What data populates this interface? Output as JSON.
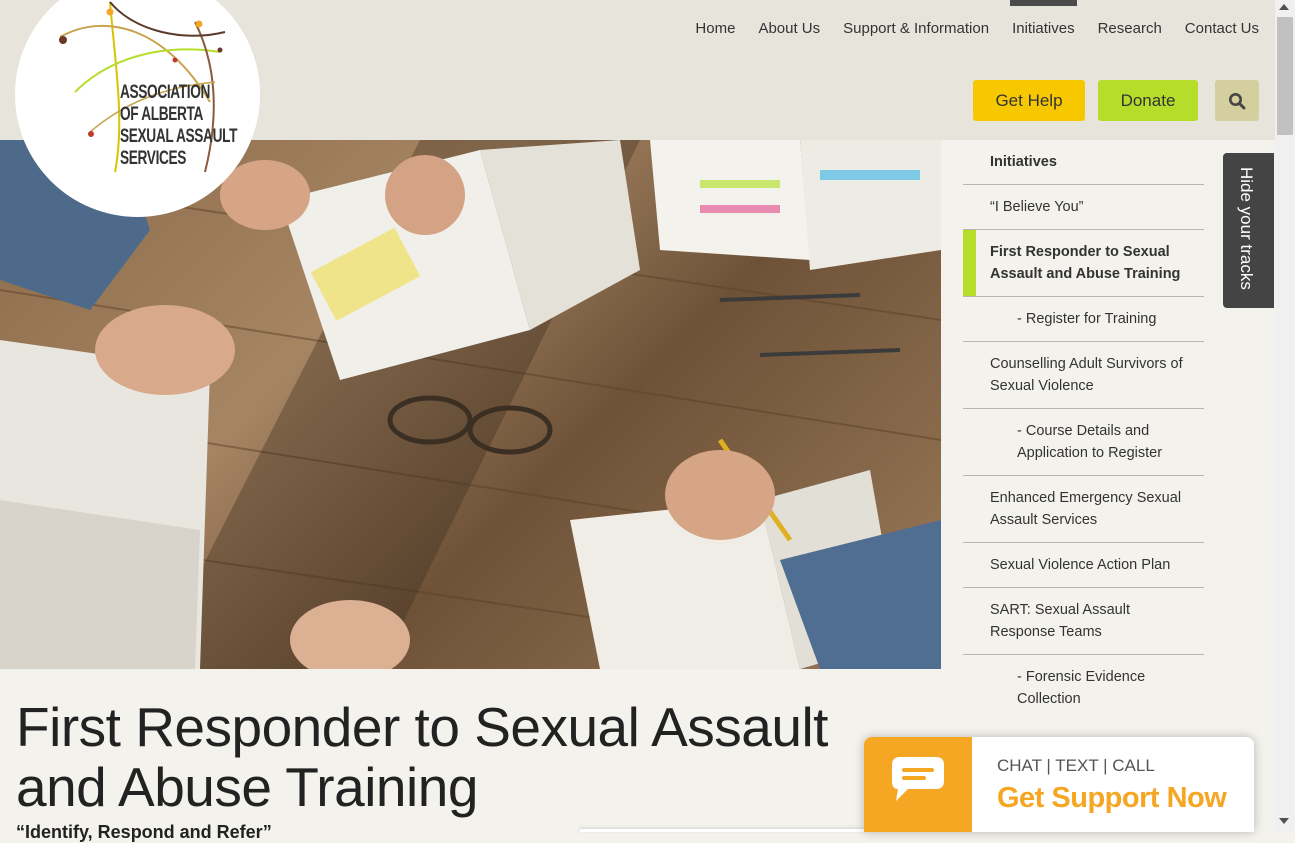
{
  "logo": {
    "lines": [
      "ASSOCIATION",
      "OF ALBERTA",
      "SEXUAL ASSAULT",
      "SERVICES"
    ]
  },
  "nav": {
    "items": [
      "Home",
      "About Us",
      "Support & Information",
      "Initiatives",
      "Research",
      "Contact Us"
    ],
    "active": "Initiatives"
  },
  "actions": {
    "get_help": "Get Help",
    "donate": "Donate",
    "search_icon": "search-icon"
  },
  "hero": {
    "description": ""
  },
  "sidebar": {
    "items": [
      {
        "label": "Initiatives",
        "type": "head"
      },
      {
        "label": "“I Believe You”",
        "type": "item"
      },
      {
        "label": "First Responder to Sexual Assault and Abuse Training",
        "type": "active"
      },
      {
        "label": "- Register for Training",
        "type": "sub"
      },
      {
        "label": "Counselling Adult Survivors of Sexual Violence",
        "type": "item"
      },
      {
        "label": "- Course Details and Application to Register",
        "type": "sub"
      },
      {
        "label": "Enhanced Emergency Sexual Assault Services",
        "type": "item"
      },
      {
        "label": "Sexual Violence Action Plan",
        "type": "item"
      },
      {
        "label": "SART: Sexual Assault Response Teams",
        "type": "item"
      },
      {
        "label": "- Forensic Evidence Collection",
        "type": "sub"
      }
    ]
  },
  "hide_tracks": {
    "label": "Hide your tracks"
  },
  "page": {
    "title": "First Responder to Sexual Assault and Abuse Training",
    "subtitle": "“Identify, Respond and Refer”"
  },
  "chat_widget": {
    "line1": "CHAT | TEXT | CALL",
    "line2": "Get Support Now",
    "icon": "chat-bubble-icon"
  },
  "colors": {
    "help": "#f7c800",
    "donate": "#b5dd2a",
    "accent_orange": "#f5a623",
    "header_bg": "#e7e5db"
  }
}
